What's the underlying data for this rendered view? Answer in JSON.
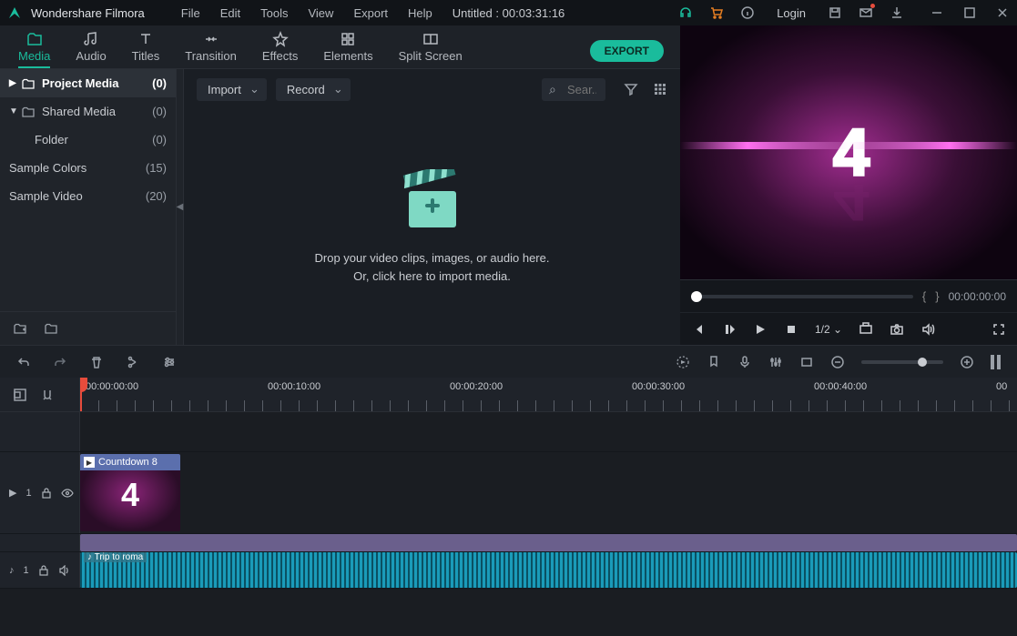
{
  "app": {
    "name": "Wondershare Filmora"
  },
  "menu": {
    "file": "File",
    "edit": "Edit",
    "tools": "Tools",
    "view": "View",
    "export": "Export",
    "help": "Help"
  },
  "project_title": "Untitled : 00:03:31:16",
  "login": "Login",
  "tabs": {
    "media": "Media",
    "audio": "Audio",
    "titles": "Titles",
    "transition": "Transition",
    "effects": "Effects",
    "elements": "Elements",
    "splitscreen": "Split Screen"
  },
  "export_btn": "EXPORT",
  "sidebar": {
    "items": [
      {
        "label": "Project Media",
        "count": "(0)"
      },
      {
        "label": "Shared Media",
        "count": "(0)"
      },
      {
        "label": "Folder",
        "count": "(0)"
      },
      {
        "label": "Sample Colors",
        "count": "(15)"
      },
      {
        "label": "Sample Video",
        "count": "(20)"
      }
    ]
  },
  "media": {
    "import": "Import",
    "record": "Record",
    "search_placeholder": "Sear...",
    "drop1": "Drop your video clips, images, or audio here.",
    "drop2": "Or, click here to import media."
  },
  "preview": {
    "digit": "4",
    "brace_open": "{",
    "brace_close": "}",
    "timecode": "00:00:00:00",
    "zoom": "1/2"
  },
  "ruler": {
    "t0": "00:00:00:00",
    "t1": "00:00:10:00",
    "t2": "00:00:20:00",
    "t3": "00:00:30:00",
    "t4": "00:00:40:00",
    "t5": "00"
  },
  "tracks": {
    "video_label": "1",
    "audio_label": "1",
    "clip_name": "Countdown 8",
    "clip_digit": "4",
    "audio_clip": "Trip to roma"
  }
}
